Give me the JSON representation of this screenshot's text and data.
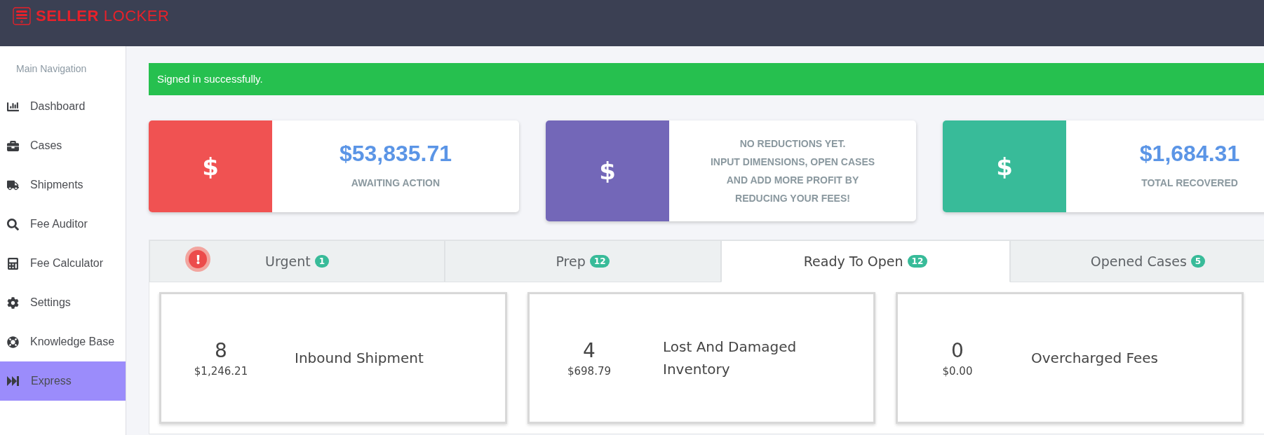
{
  "header": {
    "logo_bold": "SELLER",
    "logo_light": "LOCKER"
  },
  "sidebar": {
    "heading": "Main Navigation",
    "items": [
      {
        "label": "Dashboard",
        "kind": "chart",
        "selected": false
      },
      {
        "label": "Cases",
        "kind": "briefcase",
        "selected": false
      },
      {
        "label": "Shipments",
        "kind": "truck",
        "selected": false
      },
      {
        "label": "Fee Auditor",
        "kind": "search",
        "selected": false
      },
      {
        "label": "Fee Calculator",
        "kind": "calculator",
        "selected": false
      },
      {
        "label": "Settings",
        "kind": "gear",
        "selected": false
      },
      {
        "label": "Knowledge Base",
        "kind": "lifering",
        "selected": false
      },
      {
        "label": "Express",
        "kind": "skip",
        "selected": true
      }
    ]
  },
  "alert": {
    "text": "Signed in successfully."
  },
  "stats": [
    {
      "icon": "$",
      "color": "#f05252",
      "value": "$53,835.71",
      "lines": [
        "AWAITING ACTION"
      ]
    },
    {
      "icon": "$",
      "color": "#7367b8",
      "lines": [
        "NO REDUCTIONS YET.",
        "INPUT DIMENSIONS, OPEN CASES",
        "AND ADD MORE PROFIT BY",
        "REDUCING YOUR FEES!"
      ]
    },
    {
      "icon": "$",
      "color": "#38bb99",
      "value": "$1,684.31",
      "lines": [
        "TOTAL RECOVERED"
      ]
    }
  ],
  "tabs": [
    {
      "label": "Urgent",
      "count": "1",
      "selected": false,
      "alert": true
    },
    {
      "label": "Prep",
      "count": "12",
      "selected": false,
      "alert": false
    },
    {
      "label": "Ready To Open",
      "count": "12",
      "selected": true,
      "alert": false
    },
    {
      "label": "Opened Cases",
      "count": "5",
      "selected": false,
      "alert": false
    }
  ],
  "case_cards": [
    {
      "count": "8",
      "amount": "$1,246.21",
      "title": "Inbound Shipment"
    },
    {
      "count": "4",
      "amount": "$698.79",
      "title": "Lost And Damaged Inventory"
    },
    {
      "count": "0",
      "amount": "$0.00",
      "title": "Overcharged Fees"
    }
  ]
}
